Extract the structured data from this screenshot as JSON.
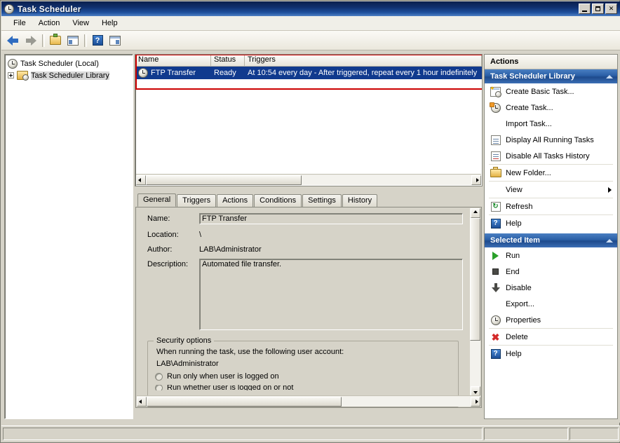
{
  "window": {
    "title": "Task Scheduler",
    "icon": "clock-icon",
    "buttons": {
      "minimize": "Minimize",
      "maximize": "Maximize",
      "close": "Close",
      "close_glyph": "✕"
    }
  },
  "menubar": {
    "items": [
      "File",
      "Action",
      "View",
      "Help"
    ]
  },
  "toolbar": {
    "items": [
      {
        "name": "back-button",
        "icon": "back-arrow-icon"
      },
      {
        "name": "forward-button",
        "icon": "forward-arrow-icon"
      },
      {
        "name": "up-one-level-button",
        "icon": "folder-up-icon"
      },
      {
        "name": "show-hide-tree-button",
        "icon": "console-tree-icon"
      },
      {
        "name": "help-button",
        "icon": "help-icon",
        "glyph": "?"
      },
      {
        "name": "show-hide-action-pane-button",
        "icon": "action-pane-icon"
      }
    ]
  },
  "tree": {
    "root": {
      "label": "Task Scheduler (Local)",
      "icon": "clock-icon"
    },
    "child": {
      "label": "Task Scheduler Library",
      "icon": "library-folder-icon",
      "selected": true,
      "expander": "+"
    }
  },
  "task_list": {
    "columns": [
      "Name",
      "Status",
      "Triggers"
    ],
    "rows": [
      {
        "name": "FTP Transfer",
        "status": "Ready",
        "triggers": "At 10:54 every day - After triggered, repeat every 1 hour indefinitely",
        "selected": true,
        "icon": "clock-icon"
      }
    ],
    "highlight_color": "#cc0000"
  },
  "detail": {
    "tabs": [
      {
        "label": "General",
        "active": true
      },
      {
        "label": "Triggers",
        "active": false
      },
      {
        "label": "Actions",
        "active": false
      },
      {
        "label": "Conditions",
        "active": false
      },
      {
        "label": "Settings",
        "active": false
      },
      {
        "label": "History",
        "active": false
      }
    ],
    "general": {
      "name_label": "Name:",
      "name_value": "FTP Transfer",
      "location_label": "Location:",
      "location_value": "\\",
      "author_label": "Author:",
      "author_value": "LAB\\Administrator",
      "description_label": "Description:",
      "description_value": "Automated file transfer."
    },
    "security": {
      "group_title": "Security options",
      "account_text": "When running the task, use the following user account:",
      "account_value": "LAB\\Administrator",
      "radio_logged_on": "Run only when user is logged on",
      "radio_whether": "Run whether user is logged on or not"
    }
  },
  "actions_pane": {
    "title": "Actions",
    "groups": [
      {
        "header": "Task Scheduler Library",
        "items": [
          {
            "label": "Create Basic Task...",
            "icon": "create-basic-task-icon"
          },
          {
            "label": "Create Task...",
            "icon": "create-task-icon"
          },
          {
            "label": "Import Task...",
            "icon": "none"
          },
          {
            "label": "Display All Running Tasks",
            "icon": "running-tasks-icon"
          },
          {
            "label": "Disable All Tasks History",
            "icon": "tasks-history-icon"
          },
          {
            "label": "New Folder...",
            "icon": "new-folder-icon",
            "separator_before": true
          },
          {
            "label": "View",
            "icon": "none",
            "submenu": true,
            "separator_before": true
          },
          {
            "label": "Refresh",
            "icon": "refresh-icon",
            "separator_before": true
          },
          {
            "label": "Help",
            "icon": "help-icon",
            "separator_before": true
          }
        ]
      },
      {
        "header": "Selected Item",
        "items": [
          {
            "label": "Run",
            "icon": "run-icon"
          },
          {
            "label": "End",
            "icon": "end-icon"
          },
          {
            "label": "Disable",
            "icon": "disable-icon"
          },
          {
            "label": "Export...",
            "icon": "none"
          },
          {
            "label": "Properties",
            "icon": "properties-clock-icon"
          },
          {
            "label": "Delete",
            "icon": "delete-icon",
            "separator_before": true
          },
          {
            "label": "Help",
            "icon": "help-icon",
            "separator_before": true
          }
        ]
      }
    ]
  },
  "statusbar": {
    "panes": [
      "",
      "",
      ""
    ]
  }
}
